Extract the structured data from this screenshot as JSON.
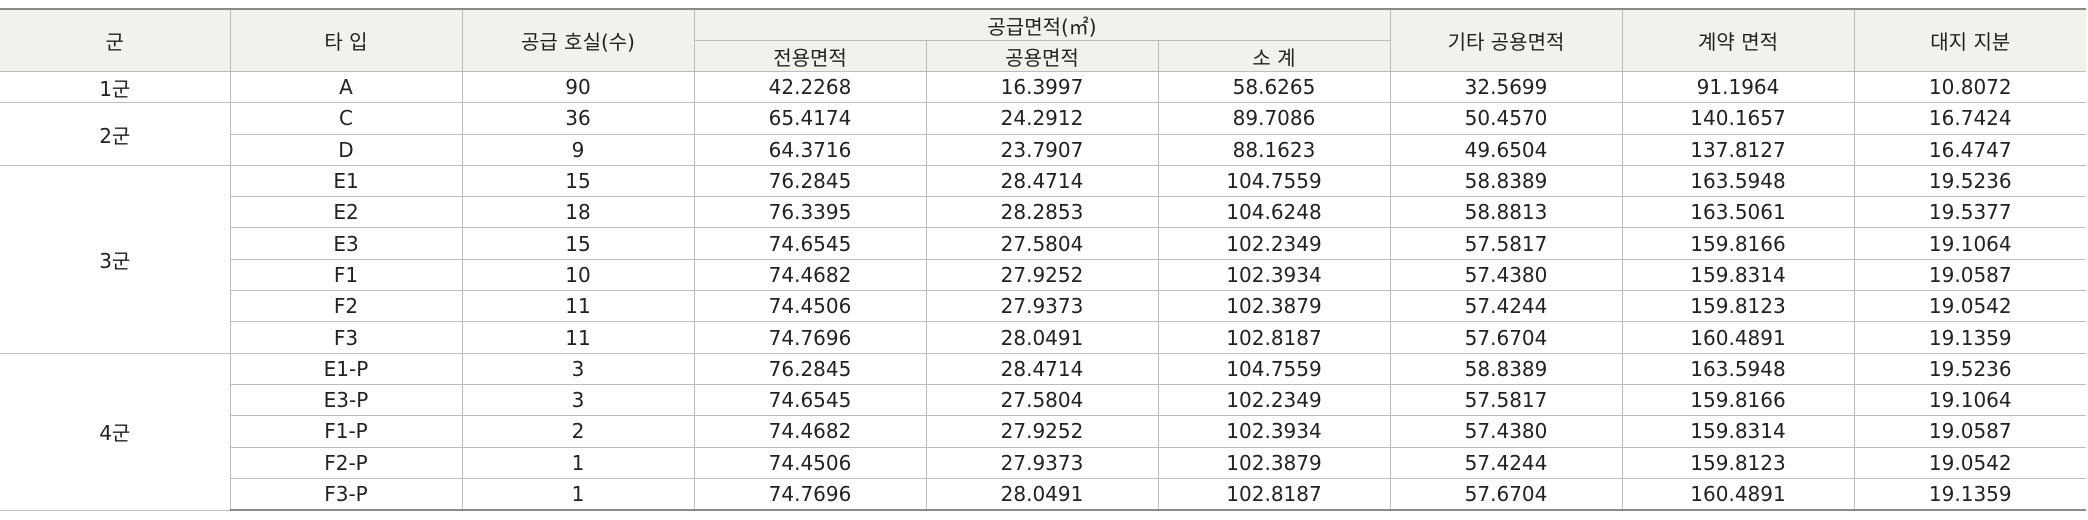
{
  "headers": {
    "group": "군",
    "type": "타 입",
    "units": "공급 호실(수)",
    "supply_area": "공급면적(㎡)",
    "exclusive": "전용면적",
    "common": "공용면적",
    "subtotal": "소 계",
    "other_common": "기타 공용면적",
    "contract": "계약 면적",
    "land_share": "대지 지분"
  },
  "groups": [
    {
      "name": "1군",
      "rows": [
        [
          "A",
          "90",
          "42.2268",
          "16.3997",
          "58.6265",
          "32.5699",
          "91.1964",
          "10.8072"
        ]
      ]
    },
    {
      "name": "2군",
      "rows": [
        [
          "C",
          "36",
          "65.4174",
          "24.2912",
          "89.7086",
          "50.4570",
          "140.1657",
          "16.7424"
        ],
        [
          "D",
          "9",
          "64.3716",
          "23.7907",
          "88.1623",
          "49.6504",
          "137.8127",
          "16.4747"
        ]
      ]
    },
    {
      "name": "3군",
      "rows": [
        [
          "E1",
          "15",
          "76.2845",
          "28.4714",
          "104.7559",
          "58.8389",
          "163.5948",
          "19.5236"
        ],
        [
          "E2",
          "18",
          "76.3395",
          "28.2853",
          "104.6248",
          "58.8813",
          "163.5061",
          "19.5377"
        ],
        [
          "E3",
          "15",
          "74.6545",
          "27.5804",
          "102.2349",
          "57.5817",
          "159.8166",
          "19.1064"
        ],
        [
          "F1",
          "10",
          "74.4682",
          "27.9252",
          "102.3934",
          "57.4380",
          "159.8314",
          "19.0587"
        ],
        [
          "F2",
          "11",
          "74.4506",
          "27.9373",
          "102.3879",
          "57.4244",
          "159.8123",
          "19.0542"
        ],
        [
          "F3",
          "11",
          "74.7696",
          "28.0491",
          "102.8187",
          "57.6704",
          "160.4891",
          "19.1359"
        ]
      ]
    },
    {
      "name": "4군",
      "rows": [
        [
          "E1-P",
          "3",
          "76.2845",
          "28.4714",
          "104.7559",
          "58.8389",
          "163.5948",
          "19.5236"
        ],
        [
          "E3-P",
          "3",
          "74.6545",
          "27.5804",
          "102.2349",
          "57.5817",
          "159.8166",
          "19.1064"
        ],
        [
          "F1-P",
          "2",
          "74.4682",
          "27.9252",
          "102.3934",
          "57.4380",
          "159.8314",
          "19.0587"
        ],
        [
          "F2-P",
          "1",
          "74.4506",
          "27.9373",
          "102.3879",
          "57.4244",
          "159.8123",
          "19.0542"
        ],
        [
          "F3-P",
          "1",
          "74.7696",
          "28.0491",
          "102.8187",
          "57.6704",
          "160.4891",
          "19.1359"
        ]
      ]
    }
  ]
}
